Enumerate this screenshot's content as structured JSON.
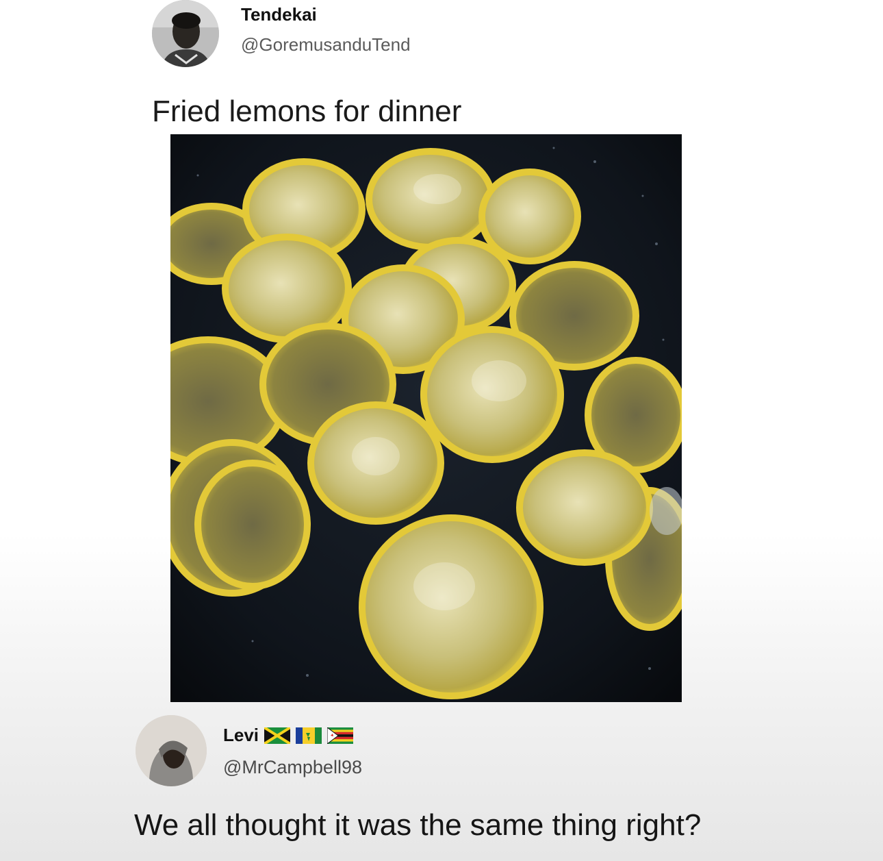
{
  "original_tweet": {
    "author_name": "Tendekai",
    "author_handle": "@GoremusanduTend",
    "avatar_icon": "profile-photo",
    "text": "Fried lemons for dinner",
    "photo_icon": "fried-lemon-slices-in-pan"
  },
  "reply_tweet": {
    "author_name": "Levi",
    "flags": [
      "jamaica-flag-icon",
      "saint-vincent-flag-icon",
      "zimbabwe-flag-icon"
    ],
    "author_handle": "@MrCampbell98",
    "avatar_icon": "profile-photo",
    "text": "We all thought it was the same thing right?"
  },
  "colors": {
    "lemon_rim": "#e9d24a",
    "lemon_flesh": "#d8cf88",
    "pan": "#0c1016"
  }
}
